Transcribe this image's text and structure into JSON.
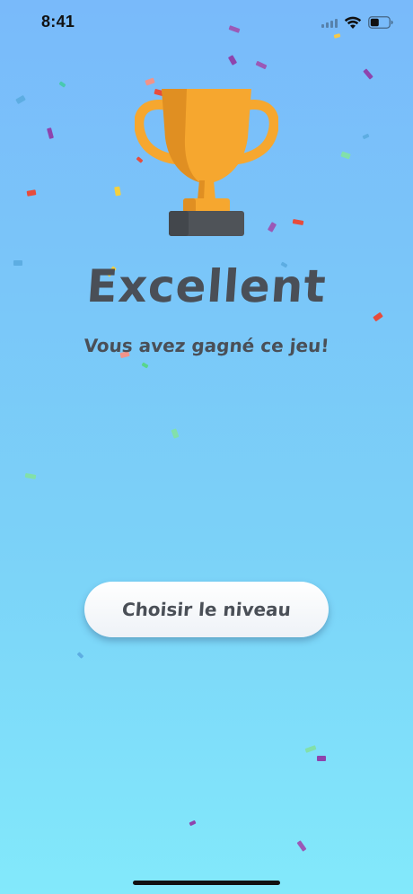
{
  "status_bar": {
    "time": "8:41"
  },
  "result": {
    "title": "Excellent",
    "subtitle": "Vous avez gagné ce jeu!"
  },
  "actions": {
    "choose_level_label": "Choisir le niveau"
  },
  "colors": {
    "background_top": "#79bafa",
    "background_bottom": "#82e9fb",
    "text": "#4a4f57",
    "trophy_gold": "#f6a72f",
    "trophy_gold_dark": "#e08f22",
    "trophy_base": "#4a4f57"
  },
  "icons": {
    "trophy": "trophy-icon",
    "wifi": "wifi-icon",
    "battery": "battery-icon",
    "signal": "cellular-signal-icon"
  }
}
